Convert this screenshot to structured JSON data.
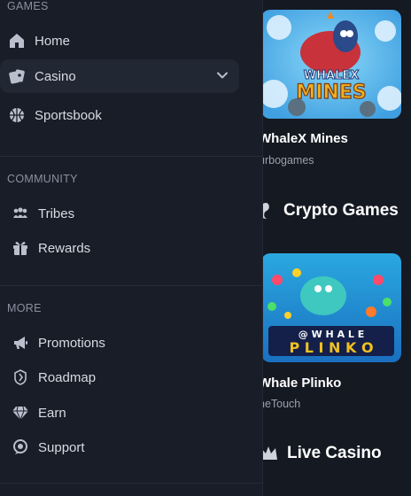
{
  "sidebar": {
    "games_label": "GAMES",
    "community_label": "COMMUNITY",
    "more_label": "MORE",
    "items": [
      {
        "label": "Home",
        "icon": "home-icon"
      },
      {
        "label": "Casino",
        "icon": "cards-icon"
      },
      {
        "label": "Sportsbook",
        "icon": "basketball-icon"
      },
      {
        "label": "Tribes",
        "icon": "tribes-icon"
      },
      {
        "label": "Rewards",
        "icon": "gift-icon"
      },
      {
        "label": "Promotions",
        "icon": "megaphone-icon"
      },
      {
        "label": "Roadmap",
        "icon": "roadmap-icon"
      },
      {
        "label": "Earn",
        "icon": "diamond-icon"
      },
      {
        "label": "Support",
        "icon": "support-icon"
      }
    ]
  },
  "main": {
    "game1": {
      "title": "WhaleX Mines",
      "provider": "urbogames",
      "art_title": "MINES",
      "art_brand": "WHALEX"
    },
    "section1": "Crypto Games",
    "game2": {
      "title": "Whale Plinko",
      "provider": "neTouch",
      "art_top": "@ W H A L E",
      "art_bottom": "P L I N K O"
    },
    "section2": "Live Casino"
  },
  "colors": {
    "sidebar_bg": "#181d27",
    "page_bg": "#151922",
    "active_bg": "#222734",
    "text": "#d8dbe2",
    "muted": "#8a90a0"
  }
}
